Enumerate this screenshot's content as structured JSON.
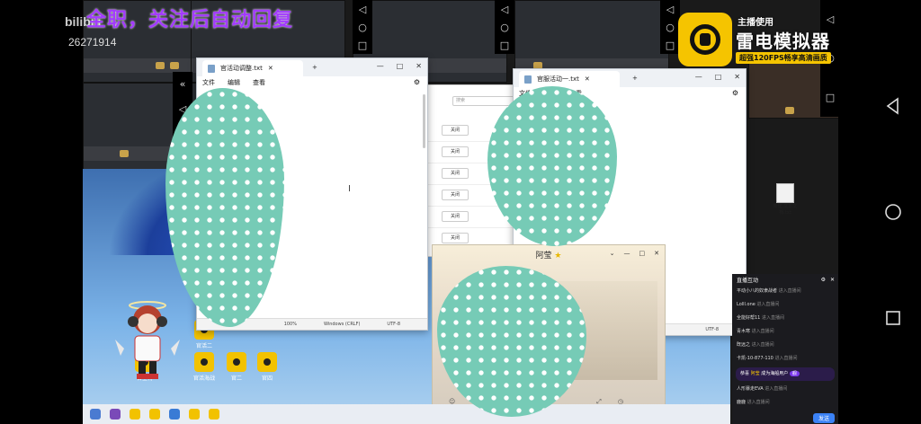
{
  "stream": {
    "overlay_title": "全职，关注后自动回复",
    "bilibili_logo": "bilibili",
    "room_id": "26271914"
  },
  "ad": {
    "line1": "主播使用",
    "line2": "雷电模拟器",
    "line3": "超强120FPS畅享高清画质"
  },
  "notepad_left": {
    "tab_title": "官活动调整.txt",
    "plus": "+",
    "menu": [
      "文件",
      "编辑",
      "查看"
    ],
    "status_zoom": "100%",
    "status_eol": "Windows (CRLF)",
    "status_enc": "UTF-8"
  },
  "notepad_right": {
    "tab_title": "官服活动一.txt",
    "plus": "+",
    "menu": [
      "文件",
      "编辑",
      "查看"
    ],
    "status_enc": "UTF-8"
  },
  "mid_panel": {
    "search_placeholder": "搜索",
    "close_label": "关闭"
  },
  "chat": {
    "title": "阿莹"
  },
  "desktop_icons": [
    {
      "label": "官活二"
    },
    {
      "label": "官活海战"
    },
    {
      "label": "官二"
    },
    {
      "label": "官四"
    },
    {
      "label": "官全特"
    }
  ],
  "desktop_file": {
    "label": "新建 文本文档.txt"
  },
  "live_chat": {
    "header": "直播互动",
    "messages": [
      {
        "user": "平动小八的奴隶战者",
        "action": "进入直播间"
      },
      {
        "user": "Lolll.one",
        "action": "进入直播间"
      },
      {
        "user": "全能好帮11",
        "action": "进入直播间"
      },
      {
        "user": "青木寒",
        "action": "进入直播间"
      },
      {
        "user": "既远之",
        "action": "进入直播间"
      },
      {
        "user": "卡凯-10-877-110",
        "action": "进入直播间"
      }
    ],
    "gift": {
      "prefix": "恭喜",
      "user": "阿莹",
      "text": "成为海船用户",
      "tag": "舰"
    },
    "messages2": [
      {
        "user": "人形暴走EVA",
        "action": "进入直播间"
      },
      {
        "user": "鹿鹿",
        "action": "进入直播间"
      }
    ],
    "send_label": "发送"
  },
  "colors": {
    "overlay_purple": "#a33bff",
    "censor_teal": "#76cbb6",
    "ad_yellow": "#f5c400"
  }
}
